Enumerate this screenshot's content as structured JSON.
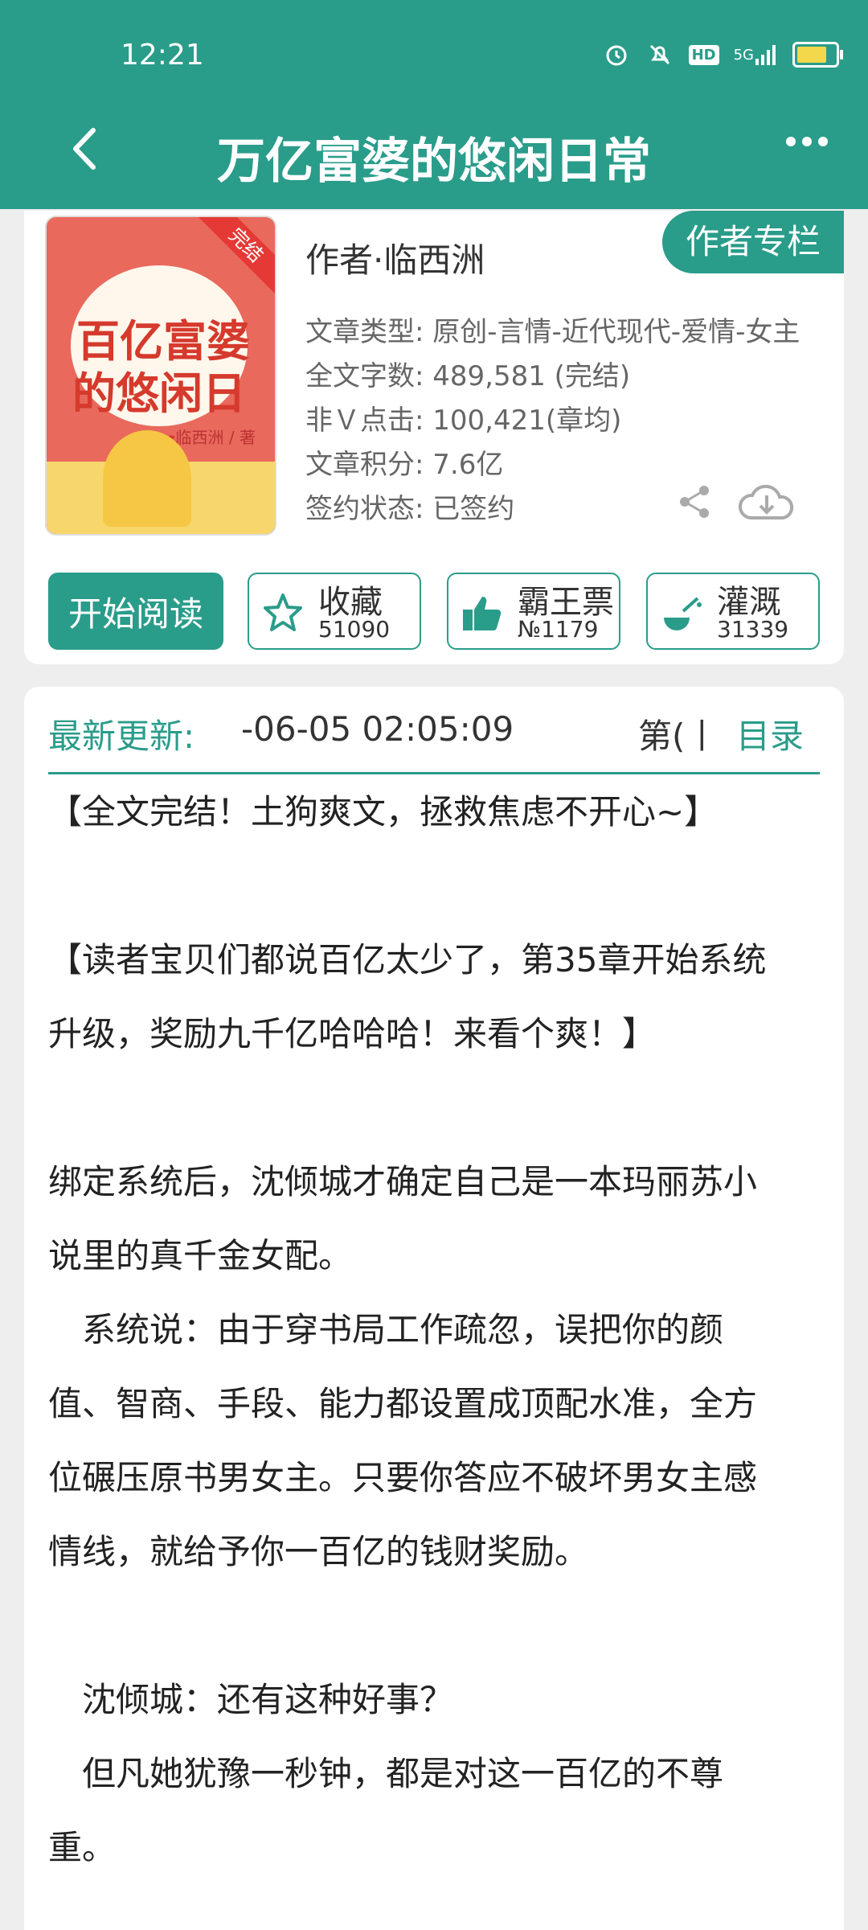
{
  "status_bar": {
    "time": "12:21",
    "icons": [
      "alarm-icon",
      "mute-icon",
      "hd-icon",
      "signal-5g-icon",
      "battery-icon"
    ],
    "hd_label": "HD",
    "network_label": "5G"
  },
  "header": {
    "title": "万亿富婆的悠闲日常",
    "background": "#2a9c8a"
  },
  "book": {
    "cover": {
      "ribbon": "完结",
      "title_line1": "百亿富婆",
      "title_line2": "的悠闲日常",
      "signature": "临西洲 / 著"
    },
    "author": "作者·临西洲",
    "author_column_label": "作者专栏",
    "meta": [
      "文章类型: 原创-言情-近代现代-爱情-女主",
      "全文字数: 489,581 (完结)",
      "非Ｖ点击: 100,421(章均)",
      "文章积分: 7.6亿",
      "签约状态: 已签约"
    ]
  },
  "actions": {
    "read_label": "开始阅读",
    "favorite": {
      "label": "收藏",
      "count": "51090"
    },
    "vote": {
      "label": "霸王票",
      "count": "№1179"
    },
    "water": {
      "label": "灌溉",
      "count": "31339"
    }
  },
  "update": {
    "label": "最新更新:",
    "time": "-06-05 02:05:09",
    "chapter": "第(丨",
    "catalog_label": "目录"
  },
  "description": [
    "【全文完结！土狗爽文，拯救焦虑不开心~】",
    "【读者宝贝们都说百亿太少了，第35章开始系统",
    "升级，奖励九千亿哈哈哈！来看个爽！】",
    "绑定系统后，沈倾城才确定自己是一本玛丽苏小",
    "说里的真千金女配。",
    "　系统说：由于穿书局工作疏忽，误把你的颜",
    "值、智商、手段、能力都设置成顶配水准，全方",
    "位碾压原书男女主。只要你答应不破坏男女主感",
    "情线，就给予你一百亿的钱财奖励。",
    "　沈倾城：还有这种好事？",
    "　但凡她犹豫一秒钟，都是对这一百亿的不尊",
    "重。"
  ]
}
